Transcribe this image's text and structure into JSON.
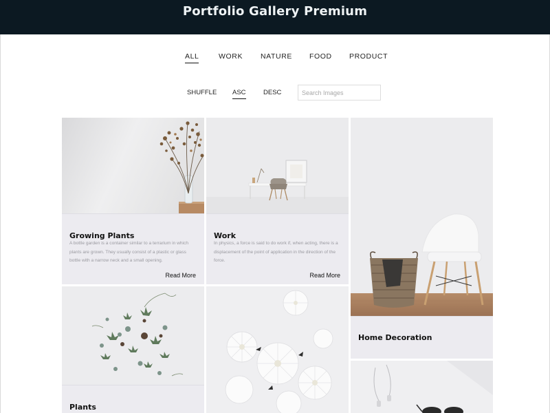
{
  "page": {
    "title": "Portfolio Gallery Premium"
  },
  "filters": {
    "all": "ALL",
    "work": "WORK",
    "nature": "NATURE",
    "food": "FOOD",
    "product": "PRODUCT"
  },
  "sort": {
    "shuffle": "SHUFFLE",
    "asc": "ASC",
    "desc": "DESC",
    "search_placeholder": "Search Images"
  },
  "cards": [
    {
      "title": "Growing Plants",
      "description": "A bottle garden is a container similar to a terrarium in which plants are grown. They usually consist of a plastic or glass bottle with a narrow neck and a small opening.",
      "read_more": "Read More"
    },
    {
      "title": "Work",
      "description": "In physics, a force is said to do work if, when acting, there is a displacement of the point of application in the direction of the force.",
      "read_more": "Read More"
    },
    {
      "title": "Home Decoration"
    },
    {
      "title": "Plants"
    },
    {
      "title": ""
    },
    {
      "title": ""
    }
  ],
  "colors": {
    "header_bg": "#0c1922",
    "card_info_bg": "#ecebf0",
    "accent": "#111111"
  }
}
